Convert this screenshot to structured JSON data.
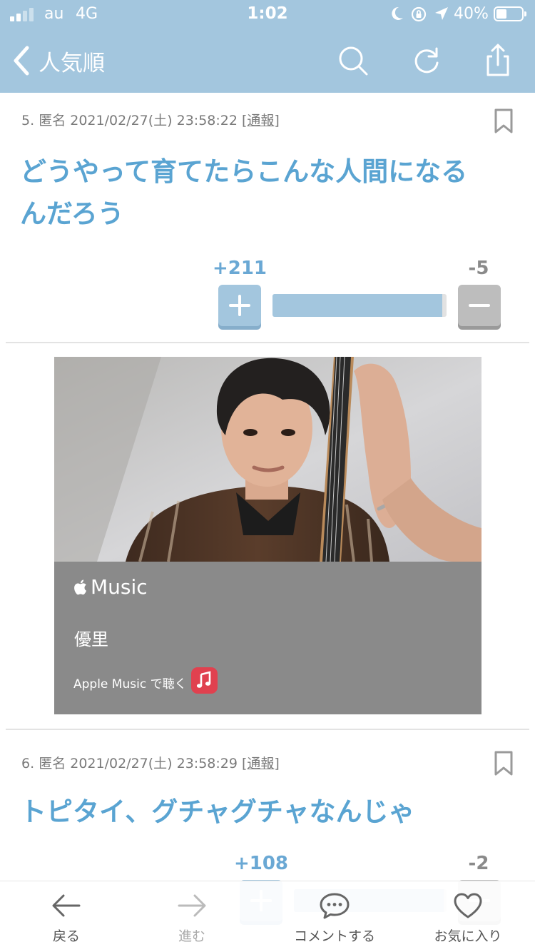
{
  "status_bar": {
    "carrier": "au",
    "network": "4G",
    "time": "1:02",
    "battery_percent": "40%",
    "battery_level": 0.4
  },
  "nav": {
    "back_label": "人気順",
    "icons": [
      "search-icon",
      "refresh-icon",
      "share-icon"
    ]
  },
  "comments": [
    {
      "number": "5.",
      "author": "匿名",
      "datetime": "2021/02/27(土) 23:58:22",
      "report_label": "[通報]",
      "text_lines": [
        "どうやって育てたらこんな人間になる",
        "んだろう"
      ],
      "plus": "+211",
      "minus": "-5",
      "plus_ratio": 0.977
    },
    {
      "number": "6.",
      "author": "匿名",
      "datetime": "2021/02/27(土) 23:58:29",
      "report_label": "[通報]",
      "text_lines": [
        "トピタイ、グチャグチャなんじゃ"
      ],
      "plus": "+108",
      "minus": "-2",
      "plus_ratio": 0.98
    }
  ],
  "embed": {
    "service": "Music",
    "artist": "優里",
    "listen_label": "Apple Music で聴く"
  },
  "toolbar": {
    "back": "戻る",
    "forward": "進む",
    "comment": "コメントする",
    "favorite": "お気に入り"
  },
  "colors": {
    "accent": "#a3c6de",
    "comment_text": "#5aa4d2",
    "minus_button": "#bdbdbd",
    "embed_bg": "#8a8a8a",
    "music_badge": "#e0414f"
  }
}
